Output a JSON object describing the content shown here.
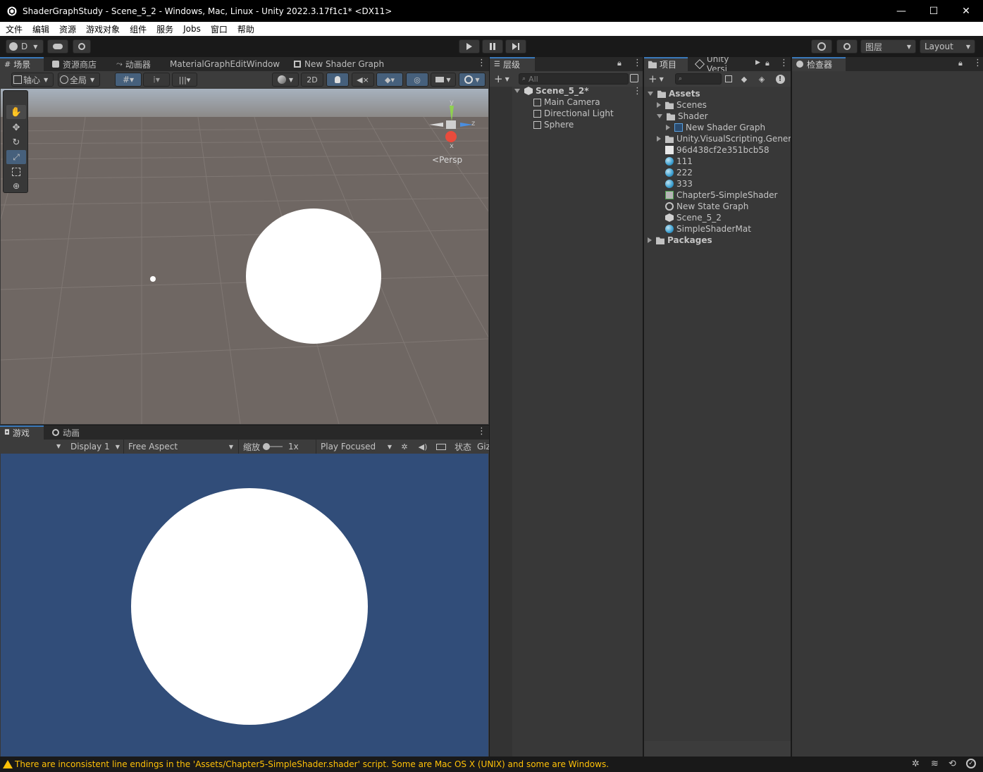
{
  "window": {
    "title": "ShaderGraphStudy - Scene_5_2 - Windows, Mac, Linux - Unity 2022.3.17f1c1* <DX11>",
    "minimize": "—",
    "maximize": "☐",
    "close": "✕"
  },
  "menu": [
    "文件",
    "编辑",
    "资源",
    "游戏对象",
    "组件",
    "服务",
    "Jobs",
    "窗口",
    "帮助"
  ],
  "toolbar": {
    "account_label": "D",
    "layers_label": "图层",
    "layout_label": "Layout"
  },
  "scene_tabs": [
    {
      "label": "场景",
      "icon": "grid-icon"
    },
    {
      "label": "资源商店",
      "icon": "store-icon"
    },
    {
      "label": "动画器",
      "icon": "animator-icon"
    },
    {
      "label": "MaterialGraphEditWindow",
      "icon": ""
    },
    {
      "label": "New Shader Graph",
      "icon": "shader-graph-icon"
    }
  ],
  "scene_toolbar": {
    "pivot": "轴心",
    "global": "全局",
    "mode_2d": "2D"
  },
  "gizmo": {
    "projection": "Persp",
    "axis_y": "y",
    "axis_z": "z",
    "axis_x": "x"
  },
  "game_tabs": [
    {
      "label": "游戏",
      "icon": "gamepad-icon"
    },
    {
      "label": "动画",
      "icon": "clock-icon"
    }
  ],
  "game_toolbar": {
    "display": "Display 1",
    "aspect": "Free Aspect",
    "scale_label": "缩放",
    "scale_value": "1x",
    "play_mode": "Play Focused",
    "stats": "状态",
    "gizmos": "Giz"
  },
  "hierarchy": {
    "tab": "层级",
    "search_placeholder": "All",
    "scene": "Scene_5_2*",
    "items": [
      "Main Camera",
      "Directional Light",
      "Sphere"
    ]
  },
  "project": {
    "tab": "项目",
    "tab2": "Unity Versi",
    "assets_root": "Assets",
    "items": [
      {
        "label": "Scenes",
        "kind": "folder",
        "indent": 1,
        "expander": "right"
      },
      {
        "label": "Shader",
        "kind": "folder",
        "indent": 1,
        "expander": "down"
      },
      {
        "label": "New Shader Graph",
        "kind": "shadergraph",
        "indent": 2,
        "expander": "right"
      },
      {
        "label": "Unity.VisualScripting.Genera",
        "kind": "folder",
        "indent": 1,
        "expander": "right"
      },
      {
        "label": "96d438cf2e351bcb58",
        "kind": "file",
        "indent": 1,
        "expander": ""
      },
      {
        "label": "111",
        "kind": "material",
        "indent": 1,
        "expander": ""
      },
      {
        "label": "222",
        "kind": "material",
        "indent": 1,
        "expander": ""
      },
      {
        "label": "333",
        "kind": "material",
        "indent": 1,
        "expander": ""
      },
      {
        "label": "Chapter5-SimpleShader",
        "kind": "shader",
        "indent": 1,
        "expander": ""
      },
      {
        "label": "New State Graph",
        "kind": "stategraph",
        "indent": 1,
        "expander": ""
      },
      {
        "label": "Scene_5_2",
        "kind": "scene",
        "indent": 1,
        "expander": ""
      },
      {
        "label": "SimpleShaderMat",
        "kind": "material",
        "indent": 1,
        "expander": ""
      }
    ],
    "packages_root": "Packages"
  },
  "inspector": {
    "tab": "检查器"
  },
  "status": {
    "message": "There are inconsistent line endings in the 'Assets/Chapter5-SimpleShader.shader' script. Some are Mac OS X (UNIX) and some are Windows."
  },
  "colors": {
    "accent": "#3a79bb",
    "game_background": "#314d79",
    "scene_ground": "#6f6763",
    "warning": "#ffc107"
  }
}
